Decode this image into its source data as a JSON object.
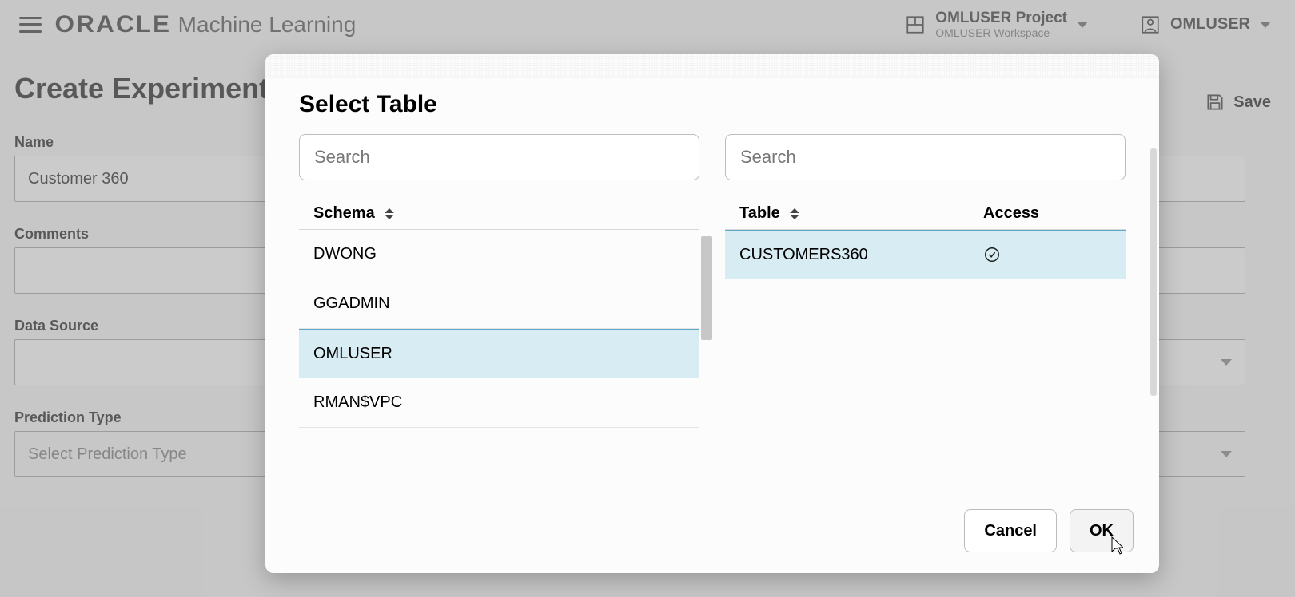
{
  "header": {
    "brand_primary": "ORACLE",
    "brand_secondary": "Machine Learning",
    "project": {
      "name": "OMLUSER Project",
      "workspace": "OMLUSER Workspace"
    },
    "user": "OMLUSER"
  },
  "page": {
    "title": "Create Experiment",
    "save_label": "Save",
    "name_field": {
      "label": "Name",
      "value": "Customer 360"
    },
    "comments_field": {
      "label": "Comments",
      "value": ""
    },
    "data_source_field": {
      "label": "Data Source",
      "value": ""
    },
    "prediction_type_field": {
      "label": "Prediction Type",
      "placeholder": "Select Prediction Type"
    }
  },
  "dialog": {
    "title": "Select Table",
    "schema_search_placeholder": "Search",
    "table_search_placeholder": "Search",
    "schema_header": "Schema",
    "table_header": "Table",
    "access_header": "Access",
    "schemas": [
      {
        "name": "DWONG",
        "selected": false
      },
      {
        "name": "GGADMIN",
        "selected": false
      },
      {
        "name": "OMLUSER",
        "selected": true
      },
      {
        "name": "RMAN$VPC",
        "selected": false
      }
    ],
    "tables": [
      {
        "name": "CUSTOMERS360",
        "access": true,
        "selected": true
      }
    ],
    "cancel_label": "Cancel",
    "ok_label": "OK"
  }
}
